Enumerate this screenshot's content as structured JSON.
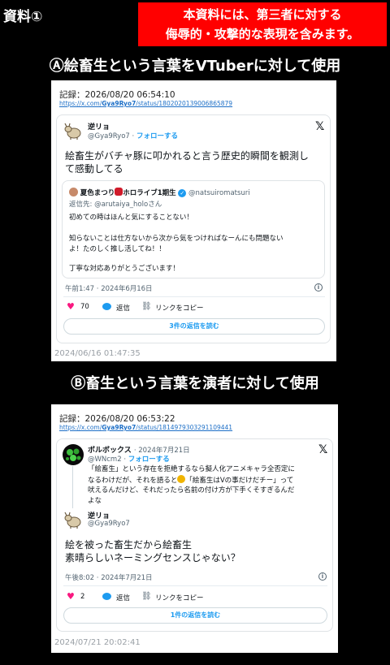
{
  "page_label": "資料①",
  "warning": {
    "line1": "本資料には、第三者に対する",
    "line2": "侮辱的・攻撃的な表現を含みます。"
  },
  "section_a": {
    "heading": "Ⓐ絵畜生という言葉をVTuberに対して使用",
    "record_label": "記録：2026/08/20 06:54:10",
    "url_prefix": "https://x.com/",
    "url_user": "Gya9Ryo7",
    "url_suffix": "/status/1802020139006865879",
    "tweet": {
      "name": "逆リョ",
      "handle": "@Gya9Ryo7",
      "dot": "·",
      "follow": "フォローする",
      "text_line1": "絵畜生がバチャ豚に叩かれると言う歴史的瞬間を観測し",
      "text_line2": "て感動してる",
      "quote": {
        "name_prefix": "夏色まつり",
        "name_suffix": "ホロライブ1期生",
        "handle": "@natsuiromatsuri",
        "reply_to": "返信先: @arutaiya_holoさん",
        "line1": "初めての時はほんと気にすることない！",
        "line2": "知らないことは仕方ないから次から気をつければなーんにも問題ない",
        "line3": "よ！たのしく推し活してね！！",
        "line4": "丁寧な対応ありがとうございます！"
      },
      "time": "午前1:47 · 2024年6月16日",
      "likes": "70",
      "reply_label": "返信",
      "copy_link": "リンクをコピー",
      "read_replies": "3件の返信を読む"
    },
    "stamp": "2024/06/16 01:47:35"
  },
  "section_b": {
    "heading": "Ⓑ畜生という言葉を演者に対して使用",
    "record_label": "記録：2026/08/20 06:53:22",
    "url_prefix": "https://x.com/",
    "url_user": "Gya9Ryo7",
    "url_suffix": "/status/1814979303291109441",
    "parent": {
      "name": "ボルボックス",
      "date": "· 2024年7月21日",
      "handle": "@WNcm2",
      "dot": "·",
      "follow": "フォローする",
      "line1": "「絵畜生」という存在を拒絶するなら擬人化アニメキャラ全否定に",
      "line2a": "なるわけだが、それを語ると",
      "line2b": "「絵畜生はVの事だけだチー」って",
      "line3": "吠えるんだけど、それだったら名前の付け方が下手くそすぎるんだ",
      "line4": "よな"
    },
    "tweet": {
      "name": "逆リョ",
      "handle": "@Gya9Ryo7",
      "text_line1": "絵を被った畜生だから絵畜生",
      "text_line2": "素晴らしいネーミングセンスじゃない？",
      "time": "午後8:02 · 2024年7月21日",
      "likes": "2",
      "reply_label": "返信",
      "copy_link": "リンクをコピー",
      "read_replies": "1件の返信を読む"
    },
    "stamp": "2024/07/21 20:02:41"
  },
  "icons": [
    "x-logo-icon",
    "heart-icon",
    "reply-bubble-icon",
    "link-icon",
    "info-icon",
    "verified-badge-icon",
    "goat-avatar-icon"
  ],
  "colors": {
    "warning_bg": "#ff0000",
    "link_blue": "#1d9bf0",
    "heart_pink": "#f91880",
    "background": "#000000"
  }
}
